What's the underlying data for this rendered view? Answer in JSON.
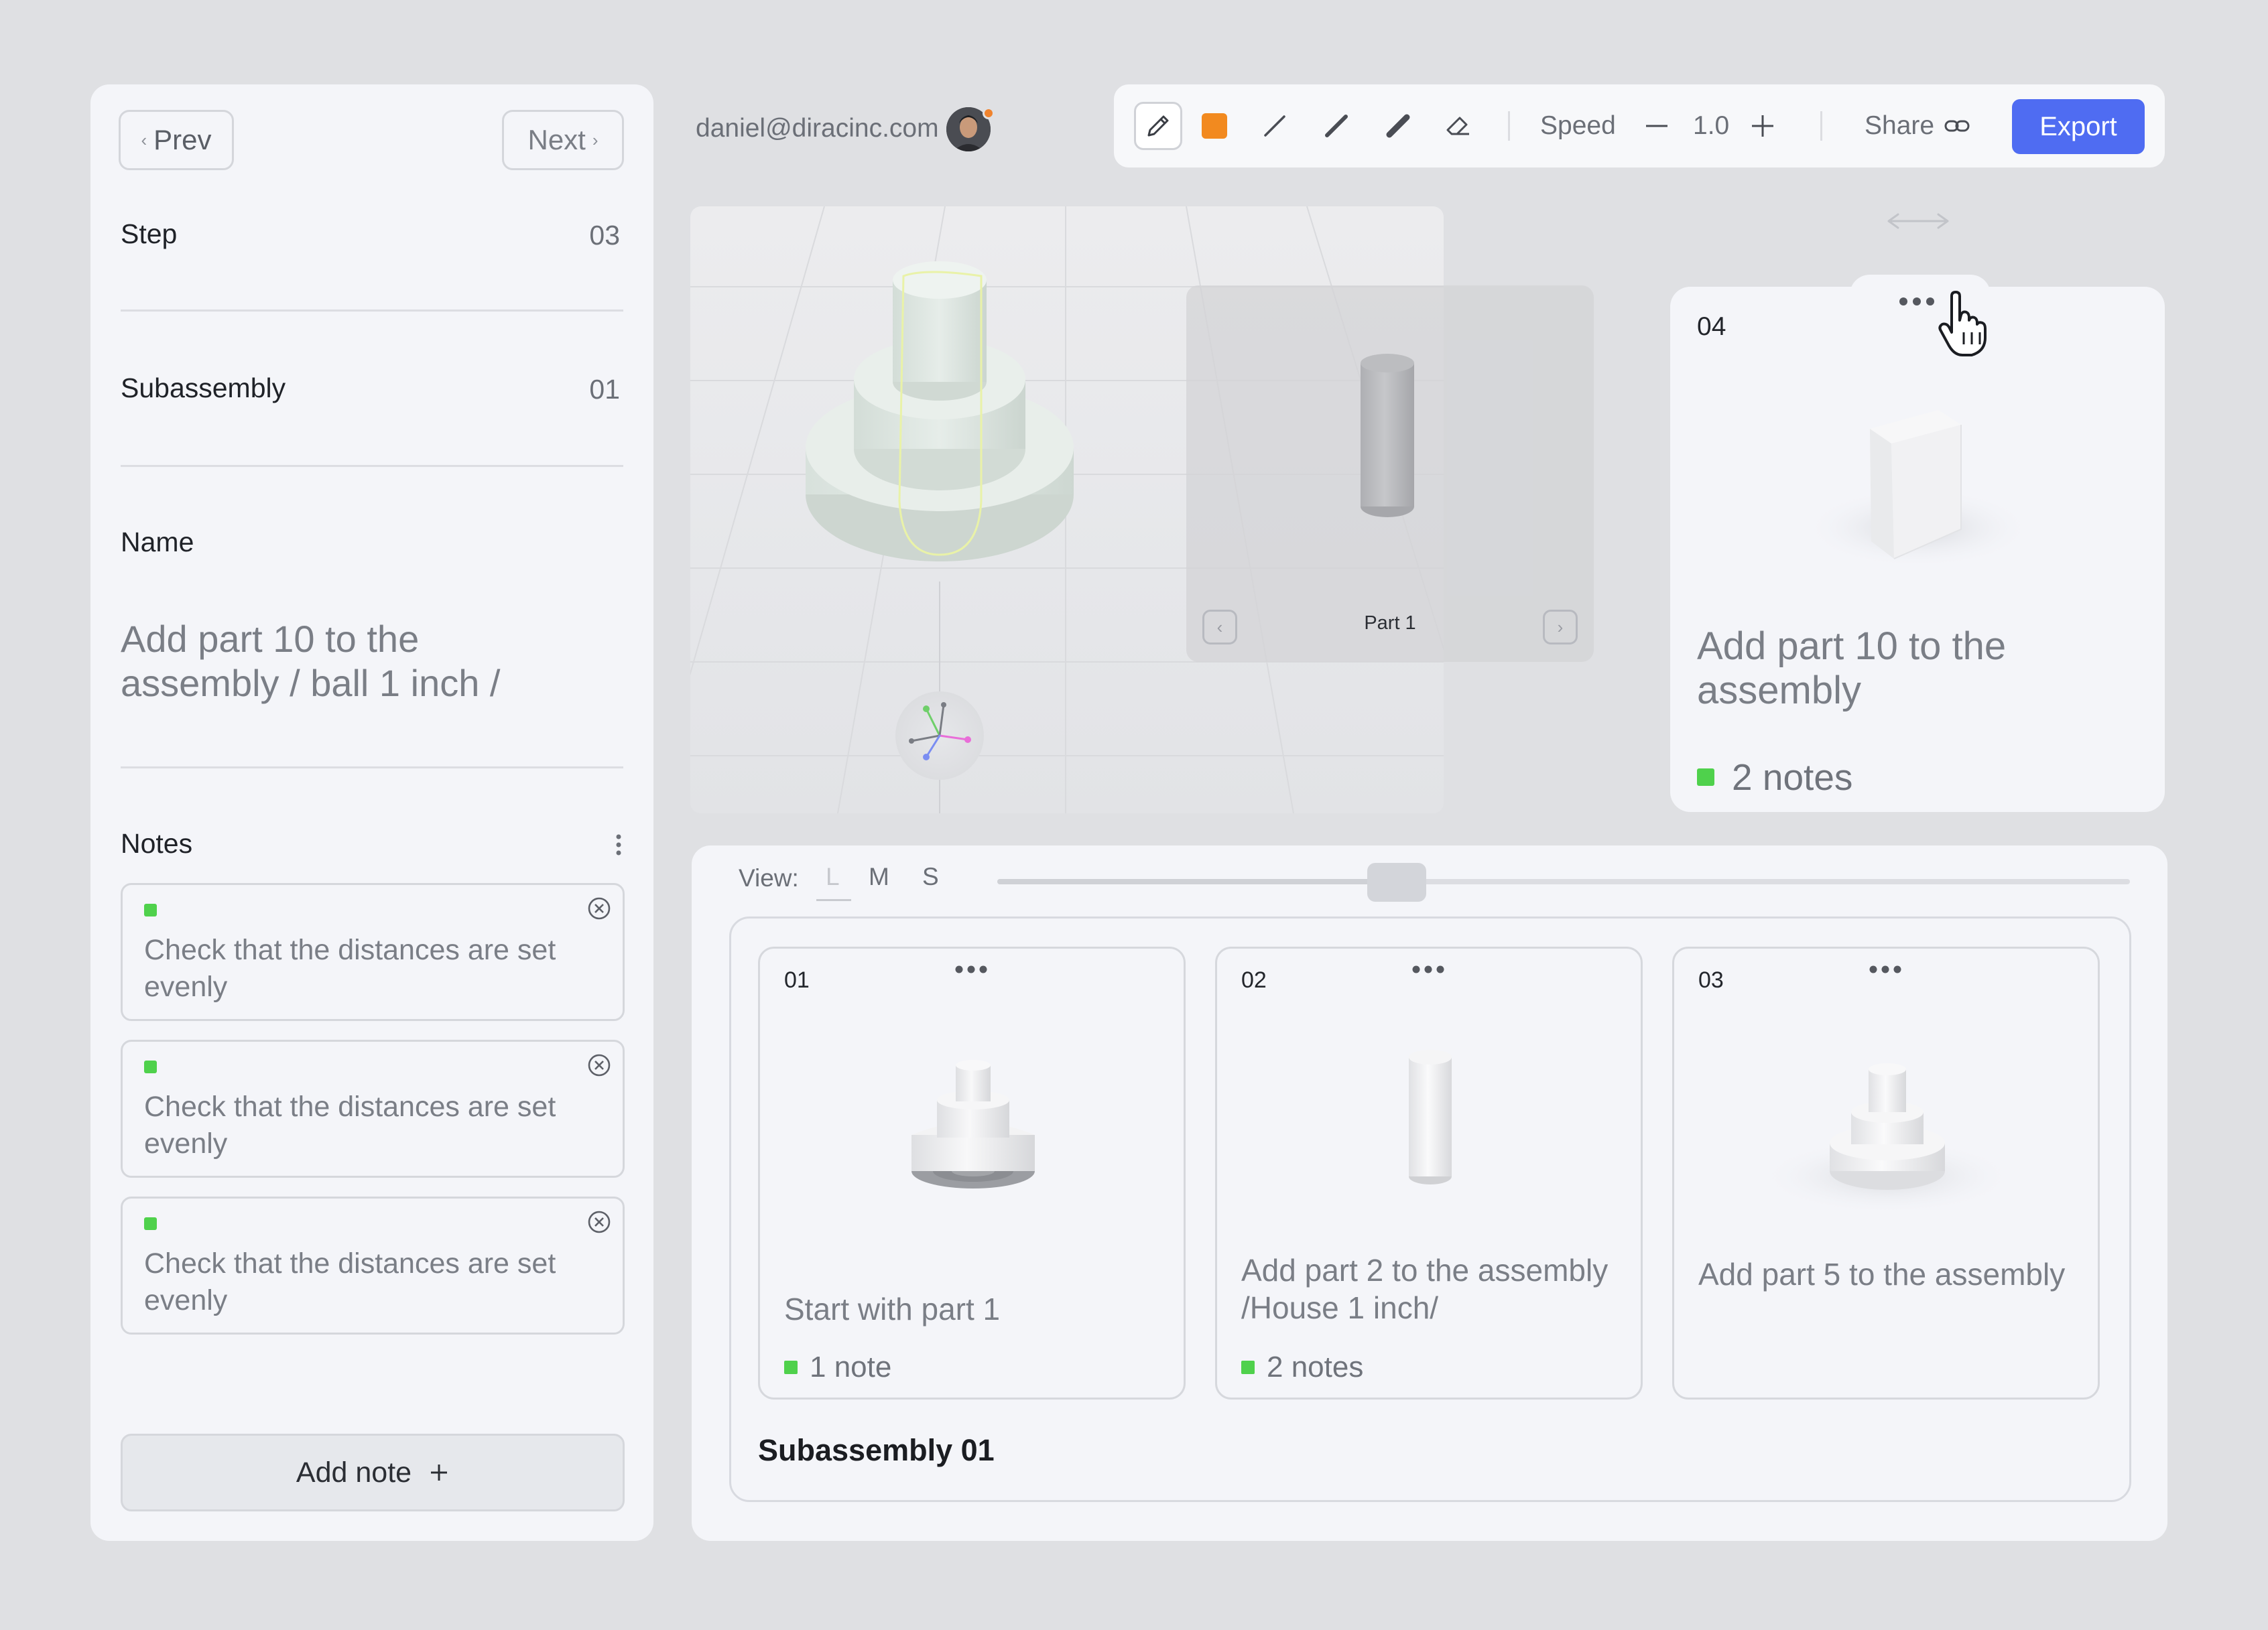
{
  "left_panel": {
    "prev_label": "Prev",
    "next_label": "Next",
    "step": {
      "label": "Step",
      "value": "03"
    },
    "subassembly": {
      "label": "Subassembly",
      "value": "01"
    },
    "name": {
      "label": "Name",
      "value": "Add part 10 to the assembly / ball 1 inch /"
    },
    "notes_label": "Notes",
    "notes": [
      {
        "text": "Check that the distances are set evenly"
      },
      {
        "text": "Check that the distances are set evenly"
      },
      {
        "text": "Check that the distances are set evenly"
      }
    ],
    "add_note_label": "Add note",
    "add_note_icon": "plus-icon"
  },
  "header": {
    "email": "daniel@diracinc.com",
    "avatar_badge_color": "#f0832d"
  },
  "toolbar": {
    "tools": [
      "pencil-icon",
      "color-swatch",
      "thin-line-icon",
      "medium-line-icon",
      "thick-line-icon",
      "eraser-icon"
    ],
    "active_color": "#f28a1f",
    "speed_label": "Speed",
    "speed_value": "1.0",
    "share_label": "Share",
    "export_label": "Export",
    "export_color": "#4f6cf2"
  },
  "viewport": {
    "part_preview_label": "Part 1"
  },
  "step_card": {
    "number": "04",
    "title": "Add part 10 to the assembly",
    "notes": "2 notes"
  },
  "bottom": {
    "view_label": "View:",
    "view_options": [
      "L",
      "M",
      "S"
    ],
    "view_selected": "L",
    "slider_fraction": 0.35,
    "subassembly_title": "Subassembly 01",
    "cards": [
      {
        "number": "01",
        "title": "Start with part 1",
        "notes": "1 note"
      },
      {
        "number": "02",
        "title": "Add part 2 to the assembly /House 1 inch/",
        "notes": "2 notes"
      },
      {
        "number": "03",
        "title": "Add part 5 to the assembly",
        "notes": ""
      }
    ]
  },
  "colors": {
    "note_status": "#4fd14c",
    "accent": "#4f6cf2"
  }
}
